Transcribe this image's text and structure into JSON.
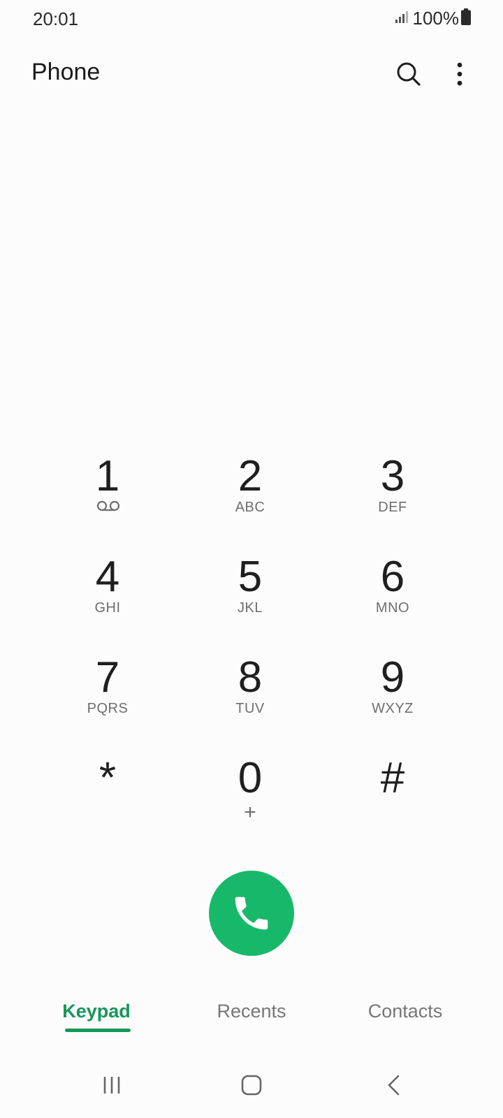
{
  "status_bar": {
    "time": "20:01",
    "battery": "100%",
    "icons": [
      "signal-icon",
      "battery-icon"
    ]
  },
  "app_bar": {
    "title": "Phone",
    "actions": [
      "search-icon",
      "more-options-icon"
    ]
  },
  "keypad": {
    "keys": [
      {
        "digit": "1",
        "letters": "",
        "icon": "voicemail-icon"
      },
      {
        "digit": "2",
        "letters": "ABC"
      },
      {
        "digit": "3",
        "letters": "DEF"
      },
      {
        "digit": "4",
        "letters": "GHI"
      },
      {
        "digit": "5",
        "letters": "JKL"
      },
      {
        "digit": "6",
        "letters": "MNO"
      },
      {
        "digit": "7",
        "letters": "PQRS"
      },
      {
        "digit": "8",
        "letters": "TUV"
      },
      {
        "digit": "9",
        "letters": "WXYZ"
      },
      {
        "digit": "*",
        "letters": ""
      },
      {
        "digit": "0",
        "letters": "+"
      },
      {
        "digit": "#",
        "letters": ""
      }
    ]
  },
  "call_button": {
    "icon": "phone-icon",
    "color": "#18b86b"
  },
  "tabs": {
    "items": [
      {
        "label": "Keypad",
        "active": true
      },
      {
        "label": "Recents",
        "active": false
      },
      {
        "label": "Contacts",
        "active": false
      }
    ],
    "active_color": "#17975a"
  },
  "nav_bar": {
    "buttons": [
      "recent-apps-icon",
      "home-icon",
      "back-icon"
    ]
  }
}
